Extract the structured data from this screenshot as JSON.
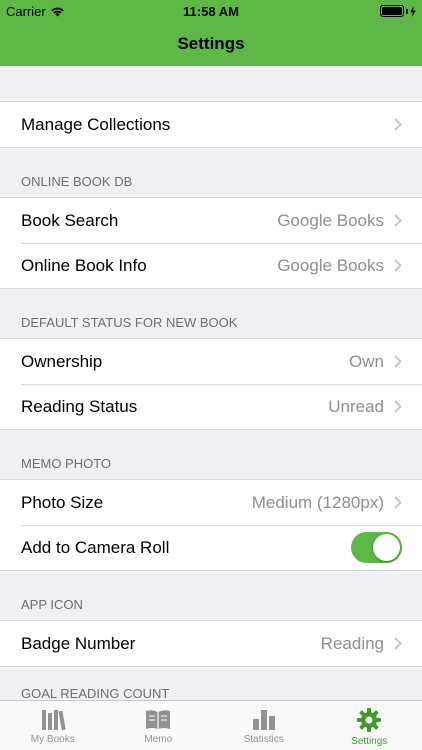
{
  "status_bar": {
    "carrier": "Carrier",
    "time": "11:58 AM"
  },
  "nav": {
    "title": "Settings"
  },
  "colors": {
    "accent": "#5eb845",
    "tab_active": "#3f9b2a"
  },
  "manage": {
    "label": "Manage Collections"
  },
  "online_db": {
    "header": "ONLINE BOOK DB",
    "book_search": {
      "label": "Book Search",
      "value": "Google Books"
    },
    "online_info": {
      "label": "Online Book Info",
      "value": "Google Books"
    }
  },
  "default_status": {
    "header": "DEFAULT STATUS FOR NEW BOOK",
    "ownership": {
      "label": "Ownership",
      "value": "Own"
    },
    "reading_status": {
      "label": "Reading Status",
      "value": "Unread"
    }
  },
  "memo_photo": {
    "header": "MEMO PHOTO",
    "photo_size": {
      "label": "Photo Size",
      "value": "Medium (1280px)"
    },
    "camera_roll": {
      "label": "Add to Camera Roll",
      "enabled": true
    }
  },
  "app_icon": {
    "header": "APP ICON",
    "badge_number": {
      "label": "Badge Number",
      "value": "Reading"
    }
  },
  "goal": {
    "header": "GOAL READING COUNT"
  },
  "tabs": [
    {
      "label": "My Books",
      "icon": "books-icon",
      "active": false
    },
    {
      "label": "Memo",
      "icon": "memo-icon",
      "active": false
    },
    {
      "label": "Statistics",
      "icon": "statistics-icon",
      "active": false
    },
    {
      "label": "Settings",
      "icon": "gear-icon",
      "active": true
    }
  ]
}
